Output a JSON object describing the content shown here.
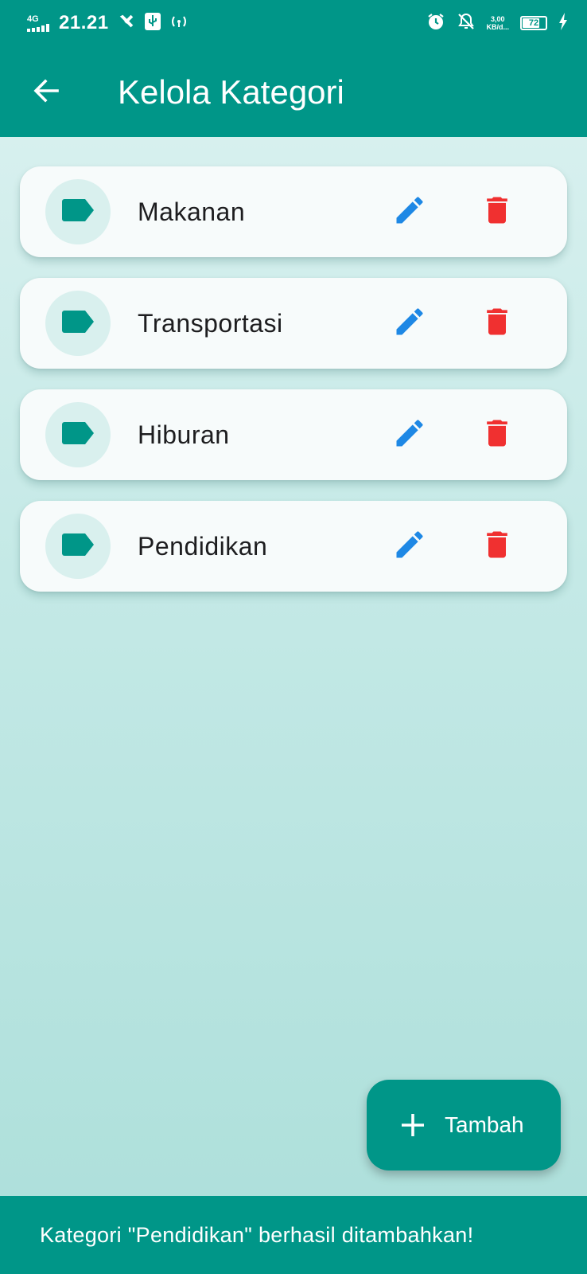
{
  "status_bar": {
    "network": "4G",
    "time": "21.21",
    "net_speed_value": "3,00",
    "net_speed_unit": "KB/d...",
    "battery": "72"
  },
  "app_bar": {
    "title": "Kelola Kategori"
  },
  "categories": [
    {
      "label": "Makanan"
    },
    {
      "label": "Transportasi"
    },
    {
      "label": "Hiburan"
    },
    {
      "label": "Pendidikan"
    }
  ],
  "fab": {
    "label": "Tambah"
  },
  "snackbar": {
    "message": "Kategori \"Pendidikan\" berhasil ditambahkan!"
  },
  "colors": {
    "primary": "#009688",
    "edit": "#1e88e5",
    "delete": "#f03030"
  },
  "icons": {
    "back": "arrow-back-icon",
    "category": "label-tag-icon",
    "edit": "pencil-icon",
    "delete": "trash-icon",
    "add": "plus-icon"
  }
}
